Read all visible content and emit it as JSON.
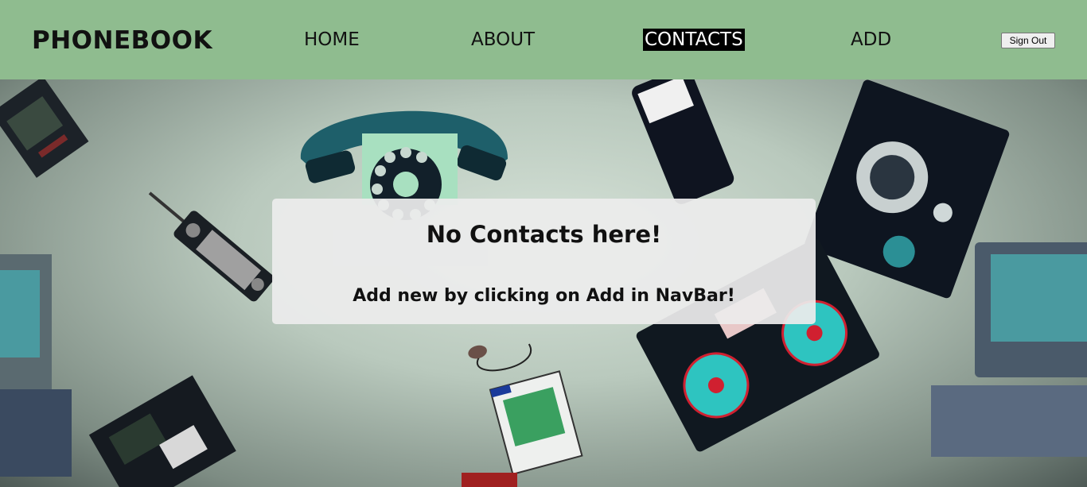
{
  "navbar": {
    "brand": "PHONEBOOK",
    "links": [
      {
        "label": "HOME"
      },
      {
        "label": "ABOUT"
      },
      {
        "label": "CONTACTS",
        "active": true
      },
      {
        "label": "ADD"
      }
    ],
    "sign_out_label": "Sign Out",
    "background_color": "#8fbc8f"
  },
  "empty_state": {
    "title": "No Contacts here!",
    "message": "Add new by clicking on Add in NavBar!"
  }
}
